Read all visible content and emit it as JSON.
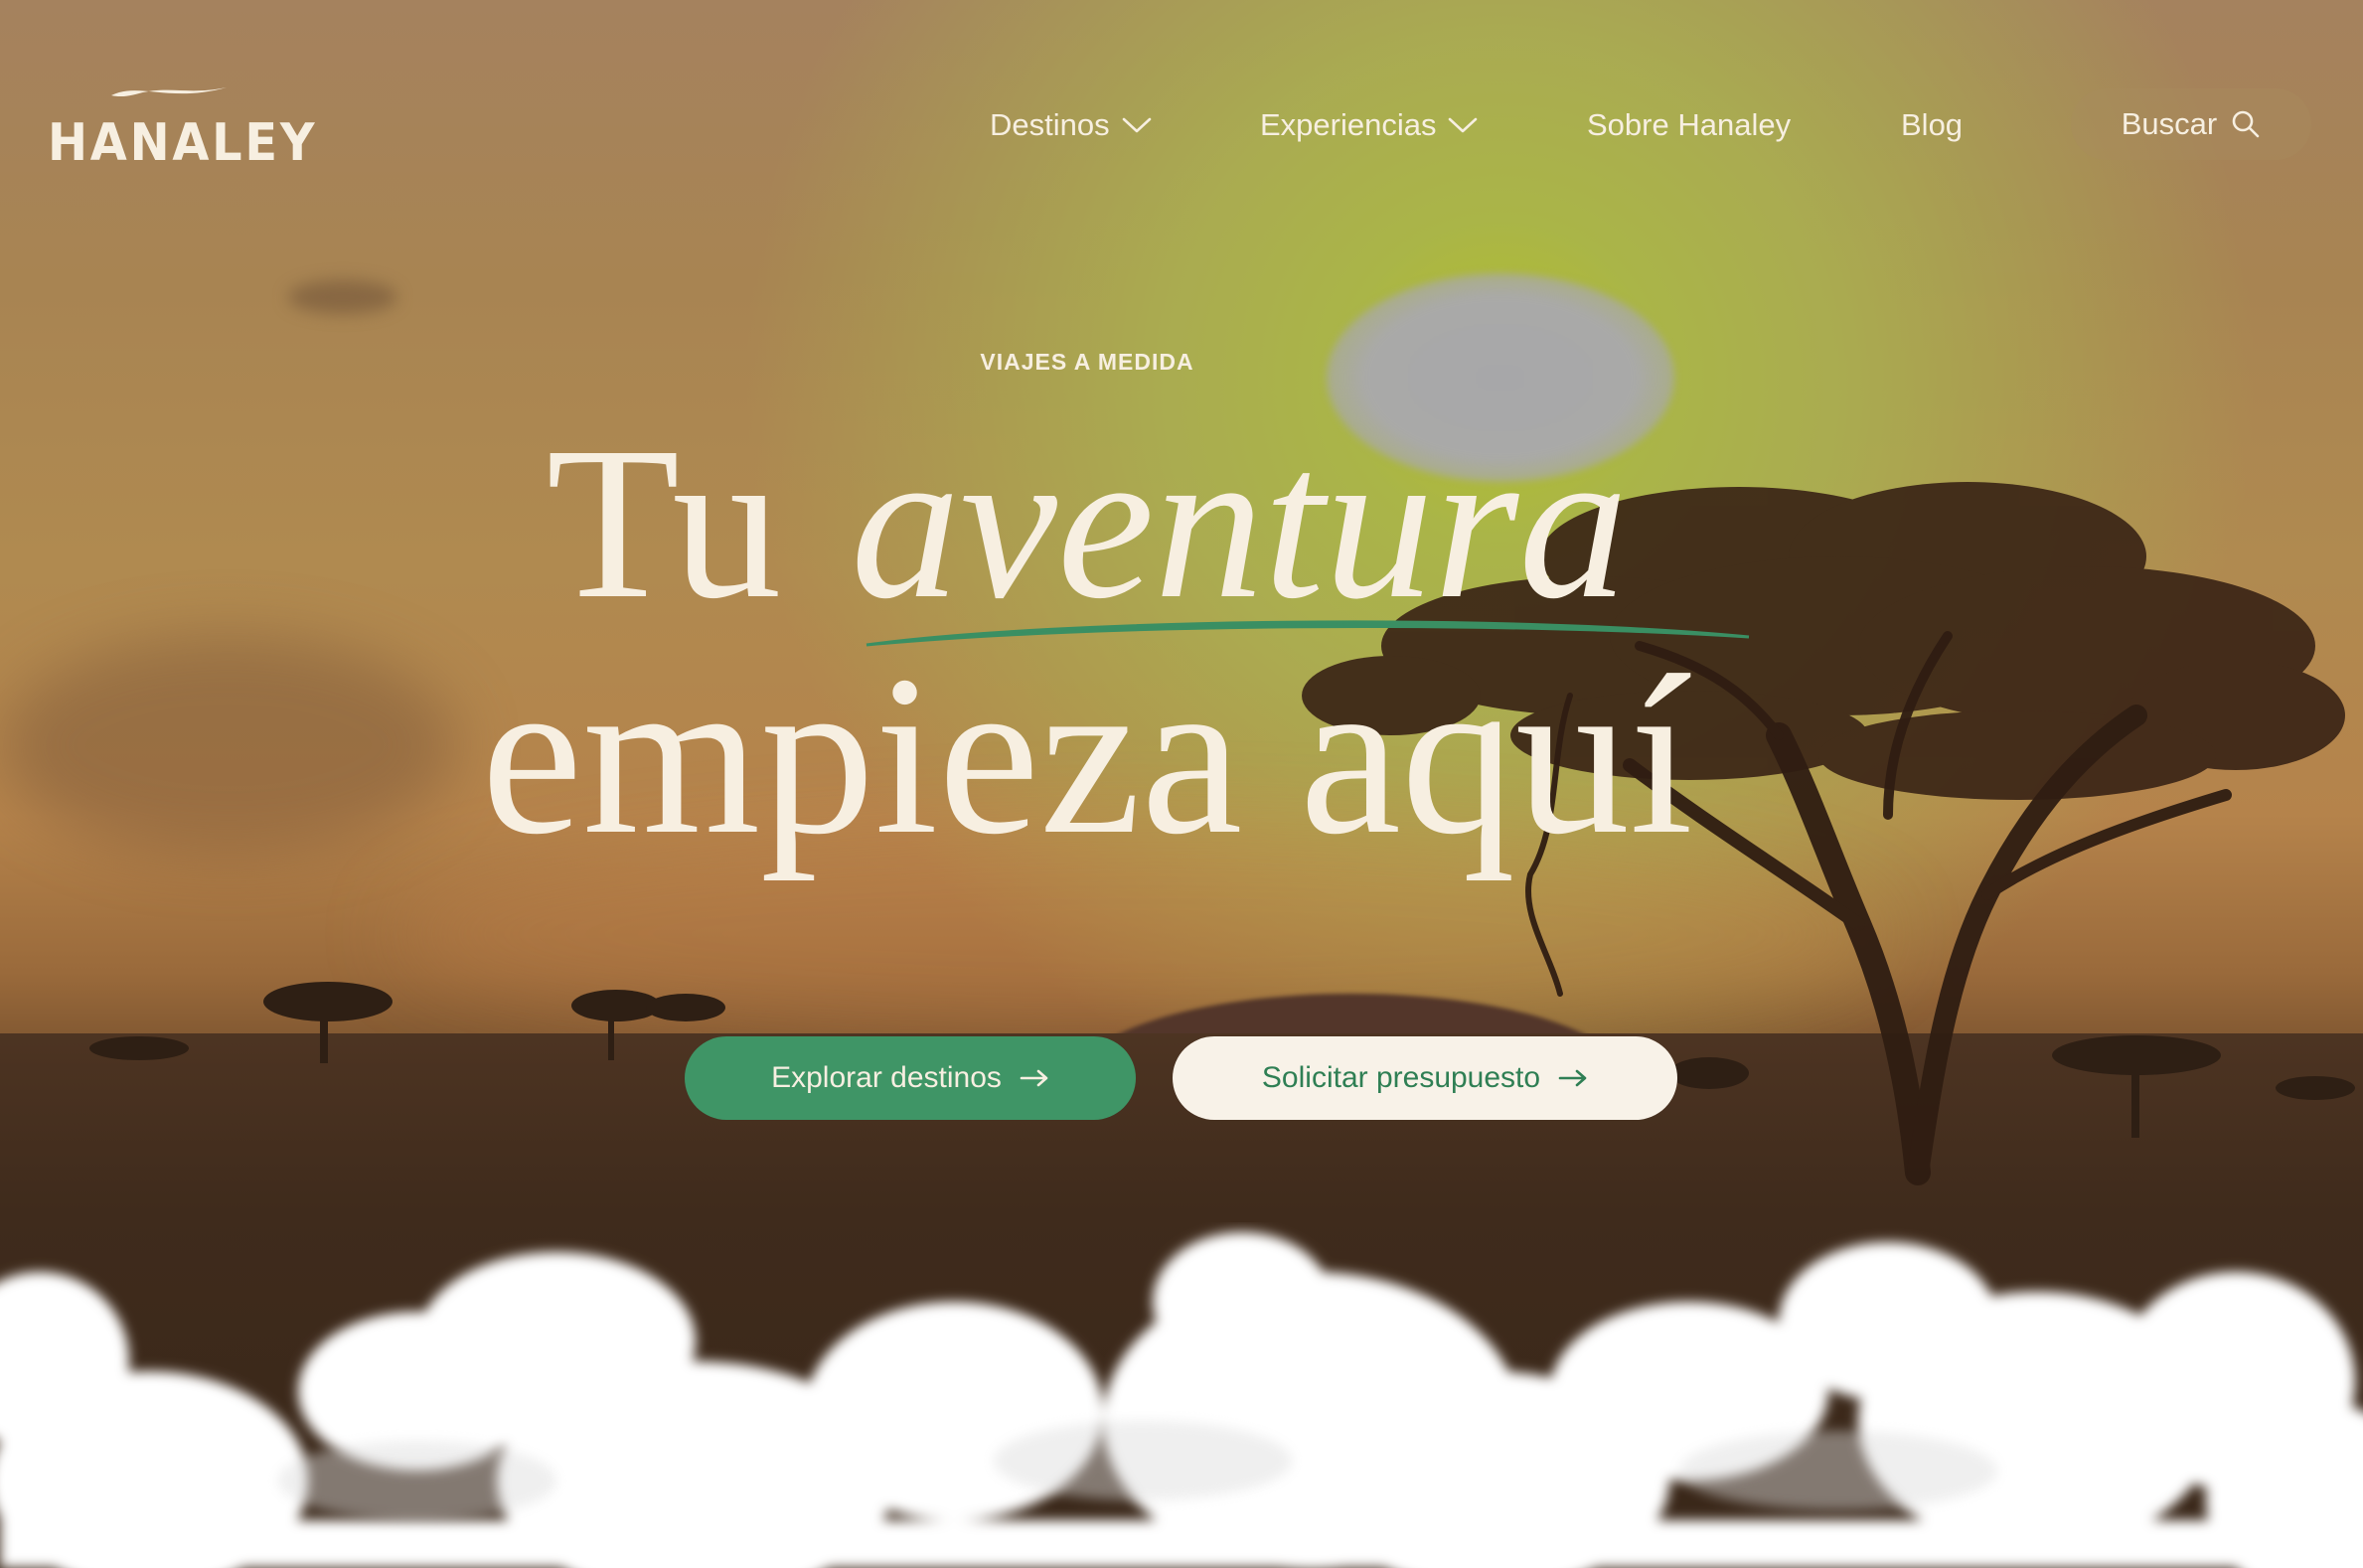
{
  "brand": {
    "logo_text": "HANALEY"
  },
  "nav": {
    "items": [
      {
        "label": "Destinos",
        "has_dropdown": true
      },
      {
        "label": "Experiencias",
        "has_dropdown": true
      },
      {
        "label": "Sobre Hanaley",
        "has_dropdown": false
      },
      {
        "label": "Blog",
        "has_dropdown": false
      }
    ],
    "search_label": "Buscar",
    "search_icon": "search-icon"
  },
  "hero": {
    "eyebrow": "VIAJES A MEDIDA",
    "headline_word_1": "Tu",
    "headline_word_2": "aventura",
    "headline_line_2": "empieza aquí"
  },
  "cta": {
    "primary_label": "Explorar destinos",
    "secondary_label": "Solicitar presupuesto",
    "arrow_icon": "arrow-right-icon"
  },
  "colors": {
    "accent_green": "#3f9566",
    "cream": "#f7efe1",
    "button_cream": "#f8f2e8",
    "green_text": "#2f7f54"
  }
}
